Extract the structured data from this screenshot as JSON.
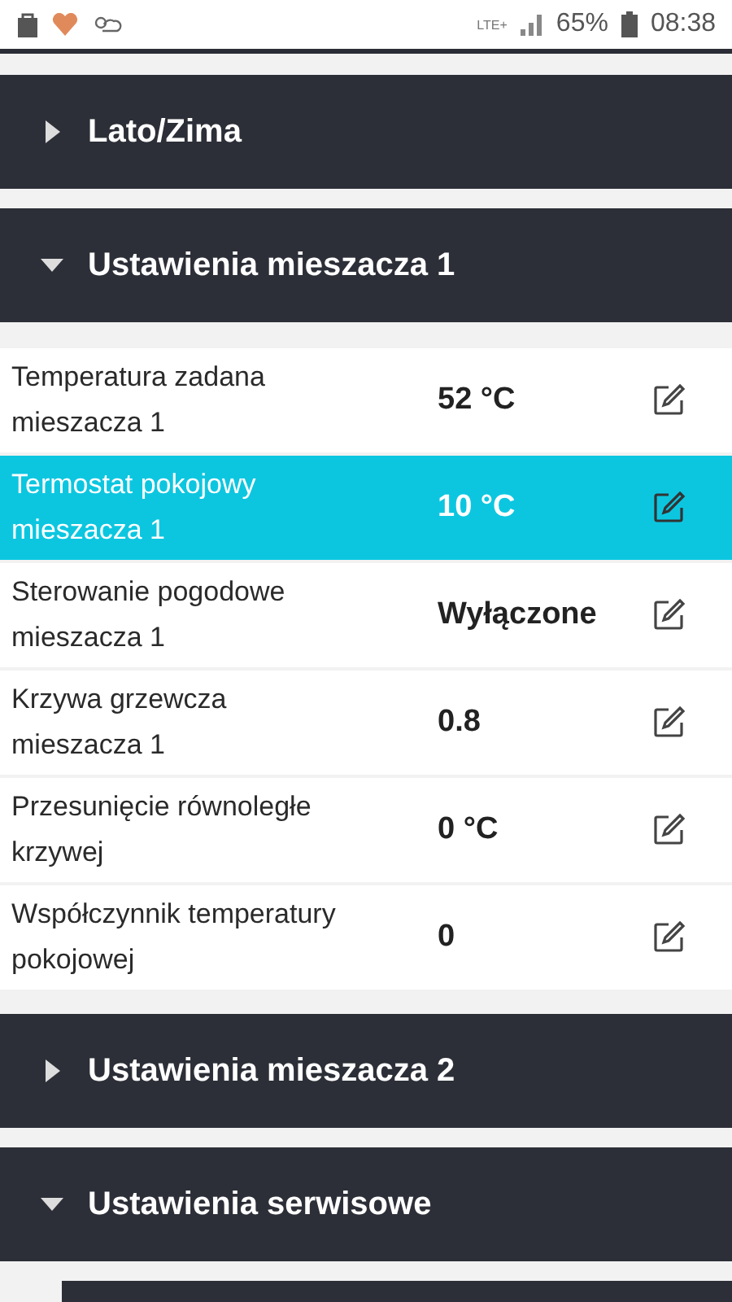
{
  "status_bar": {
    "network": "LTE+",
    "battery": "65%",
    "time": "08:38"
  },
  "sections": [
    {
      "title": "Lato/Zima",
      "expanded": false
    },
    {
      "title": "Ustawienia mieszacza 1",
      "expanded": true,
      "rows": [
        {
          "label": "Temperatura zadana mieszacza 1",
          "value": "52 °C",
          "selected": false
        },
        {
          "label": "Termostat pokojowy mieszacza 1",
          "value": "10 °C",
          "selected": true
        },
        {
          "label": "Sterowanie pogodowe mieszacza 1",
          "value": "Wyłączone",
          "selected": false
        },
        {
          "label": "Krzywa grzewcza mieszacza 1",
          "value": "0.8",
          "selected": false
        },
        {
          "label": "Przesunięcie równoległe krzywej",
          "value": "0 °C",
          "selected": false
        },
        {
          "label": "Współczynnik temperatury pokojowej",
          "value": "0",
          "selected": false
        }
      ]
    },
    {
      "title": "Ustawienia mieszacza 2",
      "expanded": false
    },
    {
      "title": "Ustawienia serwisowe",
      "expanded": true,
      "subsections": [
        {
          "kind": "panel"
        }
      ]
    }
  ]
}
